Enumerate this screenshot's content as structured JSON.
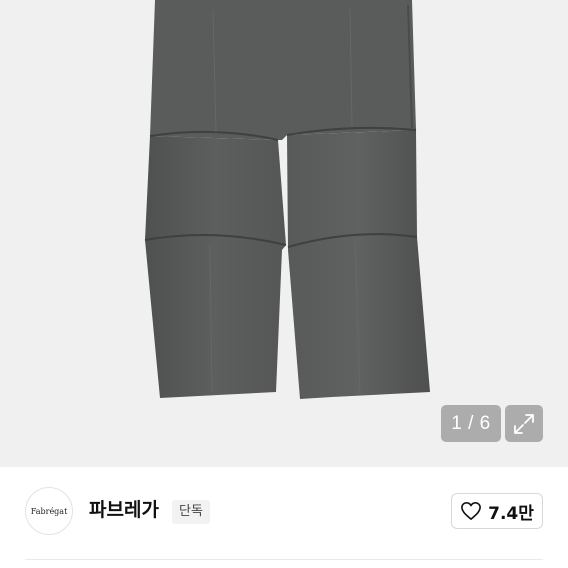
{
  "gallery": {
    "image_alt": "charcoal grey pintuck wide pants",
    "counter": "1 / 6",
    "expand_icon": "expand-arrows-icon"
  },
  "brand": {
    "logo_text": "Fabrégat",
    "name": "파브레가",
    "badge": "단독"
  },
  "like": {
    "icon": "heart-outline-icon",
    "count": "7.4만"
  },
  "colors": {
    "pants": "#5a5b5b",
    "background": "#f0f0f0"
  }
}
